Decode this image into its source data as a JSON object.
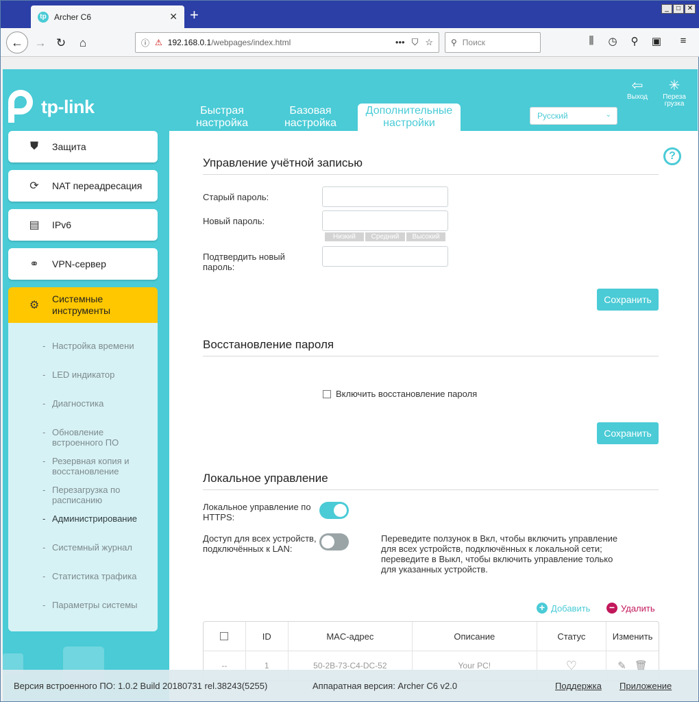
{
  "browser": {
    "tab_title": "Archer C6",
    "tab_favicon": "tp",
    "new_tab": "+",
    "url_host": "192.168.0.1",
    "url_path": "/webpages/index.html",
    "url_dots": "•••",
    "search_placeholder": "Поиск"
  },
  "header": {
    "brand": "tp-link",
    "tabs": [
      {
        "label": "Быстрая настройка"
      },
      {
        "label": "Базовая настройка"
      },
      {
        "label": "Дополнительные настройки"
      }
    ],
    "language": "Русский",
    "logout_label": "Выход",
    "reboot_label": "Перезагрузка"
  },
  "sidebar": {
    "items": [
      {
        "label": "Защита",
        "icon": "shield-icon"
      },
      {
        "label": "NAT переадресация",
        "icon": "nat-icon"
      },
      {
        "label": "IPv6",
        "icon": "ipv6-icon"
      },
      {
        "label": "VPN-сервер",
        "icon": "vpn-link-icon"
      },
      {
        "label": "Системные инструменты",
        "icon": "gear-icon"
      }
    ],
    "subitems": [
      {
        "label": "Настройка времени"
      },
      {
        "label": "LED индикатор"
      },
      {
        "label": "Диагностика"
      },
      {
        "label": "Обновление встроенного ПО"
      },
      {
        "label": "Резервная копия и восстановление"
      },
      {
        "label": "Перезагрузка по расписанию"
      },
      {
        "label": "Администрирование"
      },
      {
        "label": "Системный журнал"
      },
      {
        "label": "Статистика трафика"
      },
      {
        "label": "Параметры системы"
      }
    ],
    "dash": "-"
  },
  "account": {
    "title": "Управление учётной записью",
    "old_password_label": "Старый пароль:",
    "new_password_label": "Новый пароль:",
    "strength": [
      "Низкий",
      "Средний",
      "Высокий"
    ],
    "confirm_label": "Подтвердить новый пароль:",
    "save": "Сохранить"
  },
  "recovery": {
    "title": "Восстановление пароля",
    "enable_label": "Включить восстановление пароля",
    "save": "Сохранить"
  },
  "local": {
    "title": "Локальное управление",
    "https_label": "Локальное управление по HTTPS:",
    "https_on": true,
    "lan_label": "Доступ для всех устройств, подключённых к LAN:",
    "lan_on": false,
    "hint": "Переведите ползунок в Вкл, чтобы включить управление для всех устройств, подключённых к локальной сети; переведите в Выкл, чтобы включить управление только для указанных устройств.",
    "add": "Добавить",
    "delete": "Удалить",
    "table": {
      "headers": [
        "",
        "ID",
        "MAC-адрес",
        "Описание",
        "Статус",
        "Изменить"
      ],
      "rows": [
        {
          "select": "--",
          "id": "1",
          "mac": "50-2B-73-C4-DC-52",
          "desc": "Your PC!",
          "status": "bulb-icon"
        }
      ]
    }
  },
  "footer": {
    "firmware": "Версия встроенного ПО: 1.0.2 Build 20180731 rel.38243(5255)",
    "hardware": "Аппаратная версия: Archer C6 v2.0",
    "support": "Поддержка",
    "app": "Приложение"
  },
  "colors": {
    "accent": "#4acbd6",
    "active_menu": "#ffc700",
    "delete": "#c2185b"
  }
}
